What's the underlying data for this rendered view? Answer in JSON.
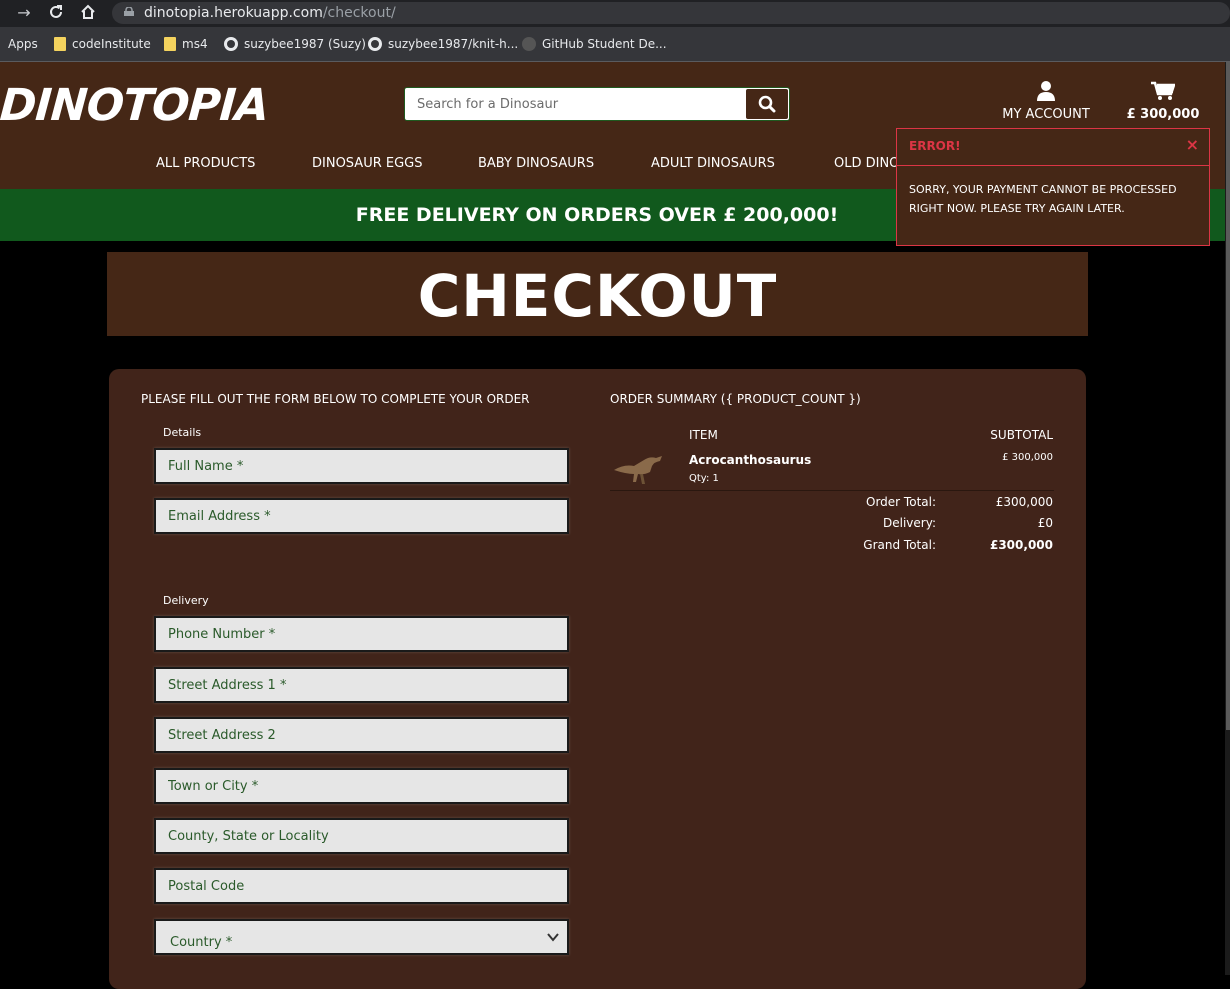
{
  "browser": {
    "url_host": "dinotopia.herokuapp.com",
    "url_path": "/checkout/",
    "bookmarks": [
      {
        "label": "Apps",
        "icon": "apps-icon"
      },
      {
        "label": "codeInstitute",
        "icon": "folder-icon"
      },
      {
        "label": "ms4",
        "icon": "folder-icon"
      },
      {
        "label": "suzybee1987 (Suzy)",
        "icon": "github-icon"
      },
      {
        "label": "suzybee1987/knit-h...",
        "icon": "github-icon"
      },
      {
        "label": "GitHub Student De...",
        "icon": "github-icon"
      }
    ]
  },
  "header": {
    "logo": "DINOTOPIA",
    "search_placeholder": "Search for a Dinosaur",
    "account_label": "MY ACCOUNT",
    "cart_total": "£ 300,000",
    "nav": [
      "ALL PRODUCTS",
      "DINOSAUR EGGS",
      "BABY DINOSAURS",
      "ADULT DINOSAURS",
      "OLD DINO"
    ]
  },
  "banner": {
    "text": "FREE DELIVERY ON ORDERS OVER £ 200,000!"
  },
  "toast": {
    "title": "ERROR!",
    "close": "×",
    "message": "SORRY, YOUR PAYMENT CANNOT BE PROCESSED RIGHT NOW. PLEASE TRY AGAIN LATER."
  },
  "page": {
    "title": "CHECKOUT"
  },
  "form": {
    "heading": "PLEASE FILL OUT THE FORM BELOW TO COMPLETE YOUR ORDER",
    "details_label": "Details",
    "delivery_label": "Delivery",
    "full_name": "Full Name *",
    "email": "Email Address *",
    "phone": "Phone Number *",
    "street1": "Street Address 1 *",
    "street2": "Street Address 2",
    "town": "Town or City *",
    "county": "County, State or Locality",
    "postcode": "Postal Code",
    "country": "Country *"
  },
  "summary": {
    "heading": "ORDER SUMMARY ({ PRODUCT_COUNT })",
    "col_item": "ITEM",
    "col_subtotal": "SUBTOTAL",
    "product_name": "Acrocanthosaurus",
    "product_qty": "Qty: 1",
    "product_subtotal": "£ 300,000",
    "order_total_label": "Order Total:",
    "order_total": "£300,000",
    "delivery_label": "Delivery:",
    "delivery": "£0",
    "grand_total_label": "Grand Total:",
    "grand_total": "£300,000"
  },
  "colors": {
    "brown": "#452716",
    "green_banner": "#11591d",
    "error_red": "#dc3545"
  }
}
